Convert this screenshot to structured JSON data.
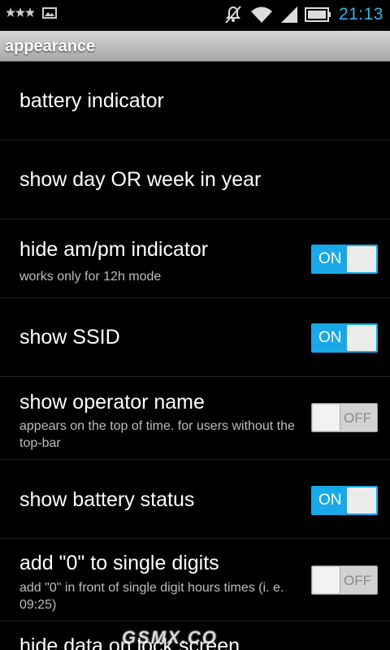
{
  "statusbar": {
    "left_icons": [
      "stars-notification-icon",
      "image-notification-icon"
    ],
    "right_icons": [
      "muted-bell-icon",
      "wifi-icon",
      "signal-icon",
      "battery-icon"
    ],
    "time": "21:13",
    "time_color": "#33b5e5"
  },
  "titlebar": {
    "title": "appearance"
  },
  "rows": [
    {
      "label": "battery indicator"
    },
    {
      "label": "show day OR week in year"
    },
    {
      "label": "hide am/pm indicator",
      "desc": "works only for 12h mode",
      "toggle": "ON",
      "state": true
    },
    {
      "label": "show SSID",
      "toggle": "ON",
      "state": true
    },
    {
      "label": "show operator name",
      "desc": "appears on the top of time. for users without the top-bar",
      "toggle": "OFF",
      "state": false
    },
    {
      "label": "show battery status",
      "toggle": "ON",
      "state": true
    },
    {
      "label": "add \"0\" to single digits",
      "desc": "add \"0\" in front of single digit hours times (i. e. 09:25)",
      "toggle": "OFF",
      "state": false
    },
    {
      "label": "hide data on lock screen"
    }
  ],
  "watermark": "GSMX.CO",
  "colors": {
    "accent": "#19a8e8",
    "background": "#000000"
  }
}
